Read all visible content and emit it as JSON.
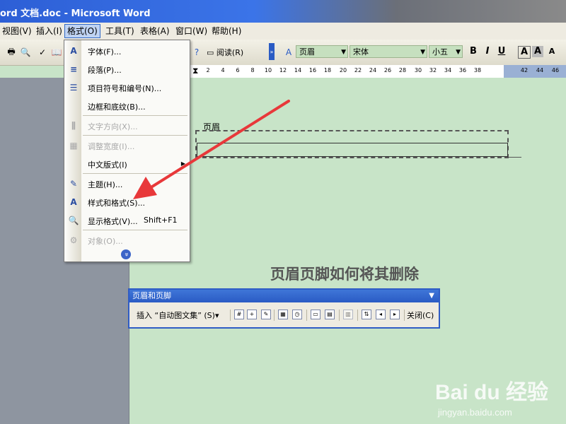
{
  "window": {
    "title": "ord 文档.doc - Microsoft Word"
  },
  "menubar": {
    "items": [
      "视图(V)",
      "插入(I)",
      "格式(O)",
      "工具(T)",
      "表格(A)",
      "窗口(W)",
      "帮助(H)"
    ],
    "active": "格式(O)"
  },
  "toolbar": {
    "read_button": "阅读(R)",
    "style_combo": "页眉",
    "font_combo": "宋体",
    "size_combo": "小五",
    "format_buttons": [
      "B",
      "I",
      "U",
      "A",
      "A",
      "A"
    ]
  },
  "ruler": {
    "ticks": [
      "2",
      "4",
      "6",
      "8",
      "10",
      "12",
      "14",
      "16",
      "18",
      "20",
      "22",
      "24",
      "26",
      "28",
      "30",
      "32",
      "34",
      "36",
      "38",
      "42",
      "44",
      "46"
    ]
  },
  "format_menu": {
    "items": [
      {
        "label": "字体(F)...",
        "icon": "font-icon",
        "disabled": false
      },
      {
        "label": "段落(P)...",
        "icon": "paragraph-icon",
        "disabled": false
      },
      {
        "label": "项目符号和编号(N)...",
        "icon": "bullets-icon",
        "disabled": false
      },
      {
        "label": "边框和底纹(B)...",
        "icon": "",
        "disabled": false
      },
      {
        "label": "文字方向(X)...",
        "icon": "text-direction-icon",
        "disabled": true
      },
      {
        "label": "调整宽度(I)...",
        "icon": "fit-width-icon",
        "disabled": true
      },
      {
        "label": "中文版式(I)",
        "icon": "",
        "disabled": false,
        "submenu": true
      },
      {
        "label": "主题(H)...",
        "icon": "theme-icon",
        "disabled": false
      },
      {
        "label": "样式和格式(S)...",
        "icon": "styles-icon",
        "disabled": false
      },
      {
        "label": "显示格式(V)...",
        "icon": "reveal-format-icon",
        "disabled": false,
        "shortcut": "Shift+F1"
      },
      {
        "label": "对象(O)...",
        "icon": "object-icon",
        "disabled": true
      }
    ],
    "expand": "»"
  },
  "document": {
    "header_label": "页眉",
    "overlay_title": "页眉页脚如何将其删除"
  },
  "hf_toolbar": {
    "title": "页眉和页脚",
    "insert_autotext": "插入 “自动图文集” (S)▾",
    "close": "关闭(C)"
  },
  "watermark": {
    "main": "Bai du 经验",
    "sub": "jingyan.baidu.com"
  },
  "colors": {
    "accent": "#2f5cc5",
    "arrow": "#e8383a",
    "doc_bg": "#c8e4c8"
  }
}
